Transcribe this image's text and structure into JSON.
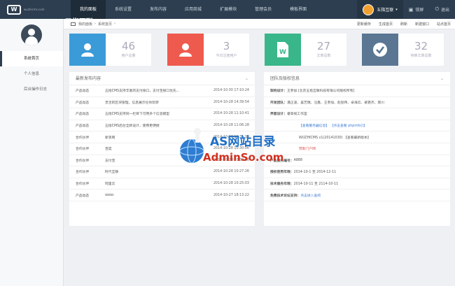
{
  "brand": {
    "sub": "wuzhicms.com",
    "main": "五指互联"
  },
  "nav": [
    "我的面板",
    "系统设置",
    "发布内容",
    "应用商城",
    "扩展模块",
    "管理会员",
    "模板界面"
  ],
  "user": {
    "name": "五指互联"
  },
  "topright": {
    "lock": "锁屏",
    "logout": "退出"
  },
  "sidebar": [
    "系统首页",
    "个人信息",
    "后台操作日志"
  ],
  "breadcrumb": {
    "home": "我的面板",
    "current": "系统首页"
  },
  "actions": [
    "更新缓存",
    "生成首页",
    "刷新",
    "新建窗口",
    "站点首页"
  ],
  "stats": [
    {
      "value": "46",
      "label": "用户总量",
      "color": "#3a9bd8"
    },
    {
      "value": "3",
      "label": "今日注册用户",
      "color": "#ee5a4e"
    },
    {
      "value": "27",
      "label": "文章总数",
      "color": "#39b68a"
    },
    {
      "value": "32",
      "label": "待审文章总数",
      "color": "#5a7693"
    }
  ],
  "latest": {
    "title": "最新发布内容",
    "rows": [
      [
        "产品动态",
        "五指CMS支持丰富的支付接口，支付宝接口优先...",
        "2014-10-30 17:10:24"
      ],
      [
        "产品动态",
        "灵活的区块管理，信息展示任你玩转",
        "2014-10-28 14:39:54"
      ],
      [
        "产品动态",
        "五指CMS支持同一栏目下可用多个信息模型",
        "2014-10-28 11:10:41"
      ],
      [
        "产品动态",
        "五指CMS后台全新设计，使用更便捷",
        "2014-10-28 11:06:28"
      ],
      [
        "合作伙伴",
        "新浪网",
        "2014-10-28 10:31:10"
      ],
      [
        "合作伙伴",
        "百度",
        "2014-10-28 10:30:06"
      ],
      [
        "合作伙伴",
        "支付宝",
        "2014-10-28 10:30:06"
      ],
      [
        "合作伙伴",
        "时代互联",
        "2014-10-28 10:27:26"
      ],
      [
        "合作伙伴",
        "阿里云",
        "2014-10-28 10:25:03"
      ],
      [
        "产品动态",
        "dddd",
        "2014-10-27 18:13:22"
      ]
    ]
  },
  "team": {
    "title": "团队及版权信息",
    "rows": [
      [
        "架构设计：",
        "王参加 [北京五指互联科技有限公司版权所有]"
      ],
      [
        "开发团队：",
        "潘正波、吴艺瑞、汪鑫、王参加、赵劲伟、卓海云、翟艳杰、郝川"
      ],
      [
        "界面设计：",
        "睿章视工作室"
      ],
      [
        "",
        "【查看服务器信息】 【点击查看 phpinfo()】"
      ],
      [
        "",
        "WUZHICMS v1(20141030) 【查看最新版本】"
      ],
      [
        "",
        "赞助门户网"
      ],
      [
        "产品服务编号：",
        "A888"
      ],
      [
        "授权使用年限：",
        "2014-10-1 至 2014-12-11"
      ],
      [
        "技术服务年限：",
        "2014-10-11 至 2114-10-11"
      ],
      [
        "免费技术论坛支持：",
        "点击进入查阅"
      ]
    ]
  },
  "watermark": {
    "title": "AS网站目录",
    "url": "AdminSo.com"
  }
}
